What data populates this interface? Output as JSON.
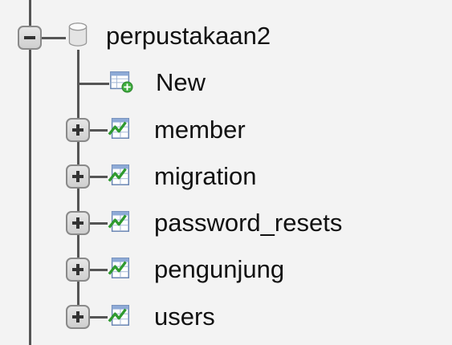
{
  "tree": {
    "database": {
      "label": "perpustakaan2",
      "expanded": true,
      "icon": "database-icon"
    },
    "new_item": {
      "label": "New",
      "icon": "new-table-icon"
    },
    "tables": [
      {
        "label": "member",
        "icon": "table-icon",
        "expanded": false
      },
      {
        "label": "migration",
        "icon": "table-icon",
        "expanded": false
      },
      {
        "label": "password_resets",
        "icon": "table-icon",
        "expanded": false
      },
      {
        "label": "pengunjung",
        "icon": "table-icon",
        "expanded": false
      },
      {
        "label": "users",
        "icon": "table-icon",
        "expanded": false
      }
    ]
  },
  "colors": {
    "background": "#f3f3f3",
    "tree_lines": "#555555",
    "text": "#111111"
  }
}
